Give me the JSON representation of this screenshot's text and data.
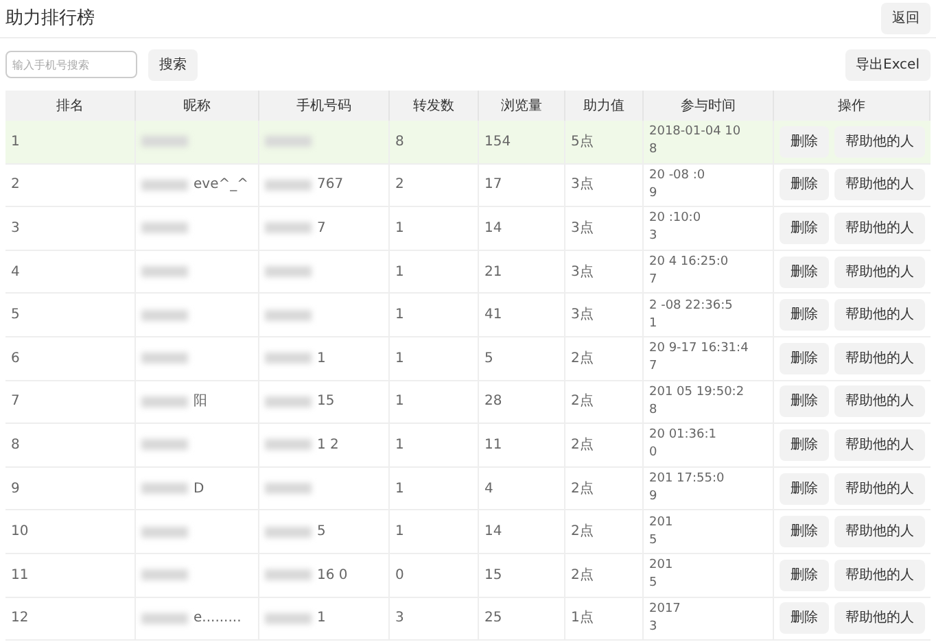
{
  "title": "助力排行榜",
  "back_button": "返回",
  "search": {
    "placeholder": "输入手机号搜索",
    "button": "搜索"
  },
  "export_button": "导出Excel",
  "table": {
    "columns": [
      "排名",
      "昵称",
      "手机号码",
      "转发数",
      "浏览量",
      "助力值",
      "参与时间",
      "操作"
    ],
    "rows": [
      {
        "rank": "1",
        "name": "",
        "phone": "",
        "shares": "8",
        "views": "154",
        "points": "5点",
        "time": [
          "2018-01-04 10",
          "8"
        ],
        "actions": [
          "删除",
          "帮助他的人"
        ],
        "selected": true
      },
      {
        "rank": "2",
        "name": "eve^_^",
        "phone": "767",
        "shares": "2",
        "views": "17",
        "points": "3点",
        "time": [
          "20 -08 :0",
          "9"
        ],
        "actions": [
          "删除",
          "帮助他的人"
        ],
        "selected": false
      },
      {
        "rank": "3",
        "name": "",
        "phone": "7",
        "shares": "1",
        "views": "14",
        "points": "3点",
        "time": [
          "20 :10:0",
          "3"
        ],
        "actions": [
          "删除",
          "帮助他的人"
        ],
        "selected": false
      },
      {
        "rank": "4",
        "name": "",
        "phone": "",
        "shares": "1",
        "views": "21",
        "points": "3点",
        "time": [
          "20 4 16:25:0",
          "7"
        ],
        "actions": [
          "删除",
          "帮助他的人"
        ],
        "selected": false
      },
      {
        "rank": "5",
        "name": "",
        "phone": "",
        "shares": "1",
        "views": "41",
        "points": "3点",
        "time": [
          "2 -08 22:36:5",
          "1"
        ],
        "actions": [
          "删除",
          "帮助他的人"
        ],
        "selected": false
      },
      {
        "rank": "6",
        "name": "",
        "phone": "1",
        "shares": "1",
        "views": "5",
        "points": "2点",
        "time": [
          "20 9-17 16:31:4",
          "7"
        ],
        "actions": [
          "删除",
          "帮助他的人"
        ],
        "selected": false
      },
      {
        "rank": "7",
        "name": "阳",
        "phone": "15",
        "shares": "1",
        "views": "28",
        "points": "2点",
        "time": [
          "201 05 19:50:2",
          "8"
        ],
        "actions": [
          "删除",
          "帮助他的人"
        ],
        "selected": false
      },
      {
        "rank": "8",
        "name": "",
        "phone": "1 2",
        "shares": "1",
        "views": "11",
        "points": "2点",
        "time": [
          "20 01:36:1",
          "0"
        ],
        "actions": [
          "删除",
          "帮助他的人"
        ],
        "selected": false
      },
      {
        "rank": "9",
        "name": "D",
        "phone": "",
        "shares": "1",
        "views": "4",
        "points": "2点",
        "time": [
          "201 17:55:0",
          "9"
        ],
        "actions": [
          "删除",
          "帮助他的人"
        ],
        "selected": false
      },
      {
        "rank": "10",
        "name": "",
        "phone": "5",
        "shares": "1",
        "views": "14",
        "points": "2点",
        "time": [
          "201",
          "5"
        ],
        "actions": [
          "删除",
          "帮助他的人"
        ],
        "selected": false
      },
      {
        "rank": "11",
        "name": "",
        "phone": "16 0",
        "shares": "0",
        "views": "15",
        "points": "2点",
        "time": [
          "201",
          "5"
        ],
        "actions": [
          "删除",
          "帮助他的人"
        ],
        "selected": false
      },
      {
        "rank": "12",
        "name": "e.........",
        "phone": "1",
        "shares": "3",
        "views": "25",
        "points": "1点",
        "time": [
          "2017",
          "3"
        ],
        "actions": [
          "删除",
          "帮助他的人"
        ],
        "selected": false
      }
    ]
  }
}
